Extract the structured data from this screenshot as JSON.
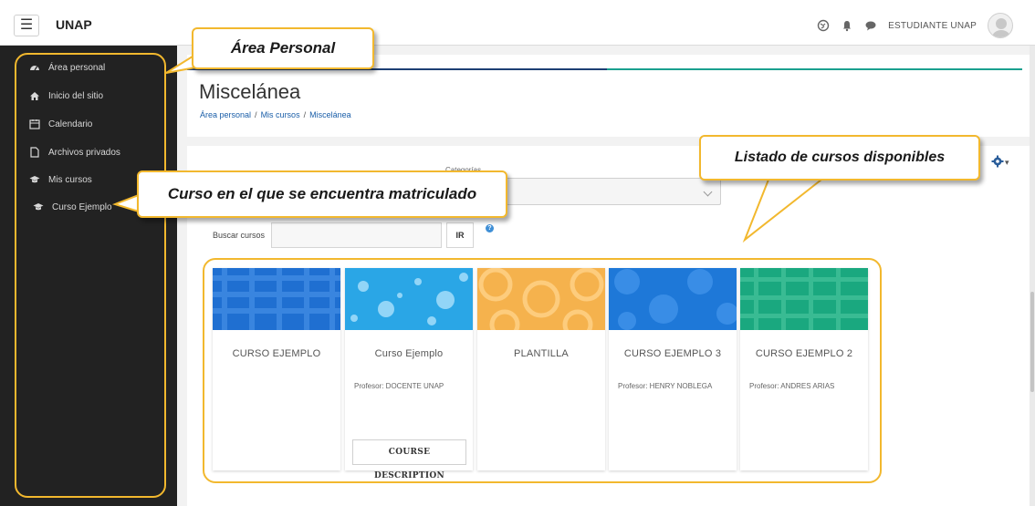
{
  "topbar": {
    "menu_icon": "hamburger-icon",
    "brand": "UNAP",
    "user_name": "ESTUDIANTE UNAP",
    "icons": [
      "globe-icon",
      "bell-icon",
      "chat-bubble-icon"
    ]
  },
  "sidebar": {
    "items": [
      {
        "label": "Área personal",
        "icon": "dashboard-icon"
      },
      {
        "label": "Inicio del sitio",
        "icon": "home-icon"
      },
      {
        "label": "Calendario",
        "icon": "calendar-icon"
      },
      {
        "label": "Archivos privados",
        "icon": "file-icon"
      },
      {
        "label": "Mis cursos",
        "icon": "graduation-cap-icon"
      },
      {
        "label": "Curso Ejemplo",
        "icon": "graduation-cap-icon"
      }
    ]
  },
  "page": {
    "title": "Miscelánea",
    "breadcrumb": [
      "Área personal",
      "Mis cursos",
      "Miscelánea"
    ],
    "category_label": "Categorías",
    "search_label": "Buscar cursos",
    "search_value": "",
    "search_button": "IR",
    "help_icon": "?",
    "settings_icon": "gear-icon"
  },
  "courses": [
    {
      "title": "CURSO EJEMPLO",
      "teacher": "",
      "button": "",
      "thumb": "blue-plaid"
    },
    {
      "title": "Curso Ejemplo",
      "teacher": "Profesor: DOCENTE UNAP",
      "button": "COURSE DESCRIPTION",
      "thumb": "blue-bokeh"
    },
    {
      "title": "PLANTILLA",
      "teacher": "",
      "button": "",
      "thumb": "orange-circles"
    },
    {
      "title": "CURSO EJEMPLO 3",
      "teacher": "Profesor: HENRY NOBLEGA",
      "button": "",
      "thumb": "blue-circles"
    },
    {
      "title": "CURSO EJEMPLO 2",
      "teacher": "Profesor: ANDRES ARIAS",
      "button": "",
      "thumb": "green-plaid"
    }
  ],
  "annotations": {
    "area_personal": "Área Personal",
    "curso_matriculado": "Curso en el que se encuentra matriculado",
    "listado_cursos": "Listado de cursos disponibles"
  },
  "colors": {
    "accent": "#f2b82e",
    "sidebar_bg": "#222222",
    "link": "#1a5ea8",
    "progress_left": "#1d3f74",
    "progress_right": "#1aa08f"
  }
}
